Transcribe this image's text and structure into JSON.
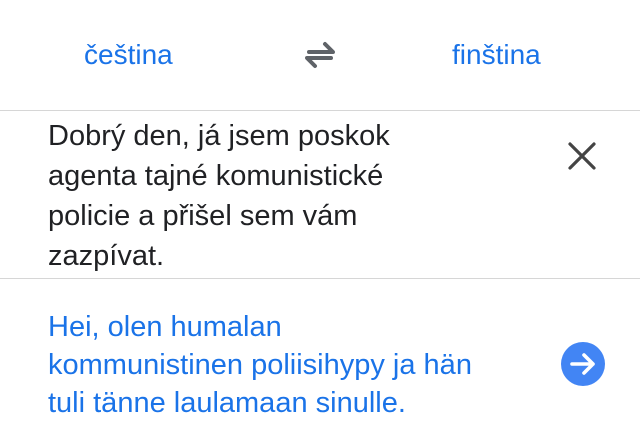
{
  "header": {
    "source_language": "čeština",
    "target_language": "finština"
  },
  "icons": {
    "swap": "swap-arrows-icon",
    "clear": "close-icon",
    "go": "arrow-right-icon"
  },
  "colors": {
    "accent": "#1a73e8",
    "button": "#4285f4",
    "text": "#202124",
    "divider": "#d6d6d6"
  },
  "source": {
    "lines": [
      "Dobrý den, já jsem poskok",
      "agenta tajné komunistické",
      "policie a přišel sem vám",
      "zazpívat."
    ]
  },
  "result": {
    "lines": [
      "Hei, olen humalan",
      "kommunistinen poliisihypy ja hän",
      "tuli tänne laulamaan sinulle."
    ]
  }
}
